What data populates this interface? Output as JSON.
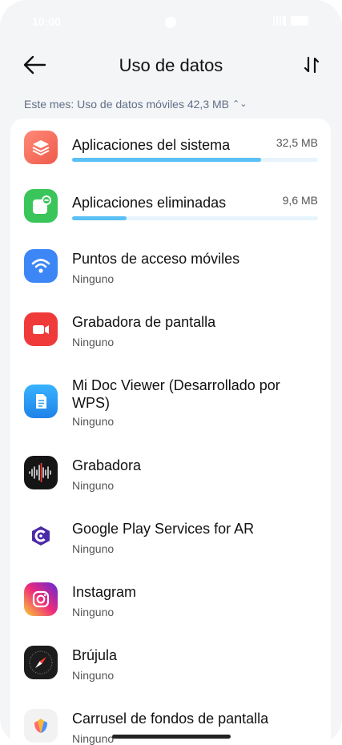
{
  "statusbar": {
    "time": "10:00"
  },
  "header": {
    "title": "Uso de datos"
  },
  "period": {
    "label": "Este mes: Uso de datos móviles 42,3 MB"
  },
  "apps": [
    {
      "name": "Aplicaciones del sistema",
      "usage": "32,5 MB",
      "fraction": 0.77,
      "icon": "layers-icon",
      "color": "#f06b5a"
    },
    {
      "name": "Aplicaciones eliminadas",
      "usage": "9,6 MB",
      "fraction": 0.22,
      "icon": "removed-apps-icon",
      "color": "#3ac55b"
    },
    {
      "name": "Puntos de acceso móviles",
      "sub": "Ninguno",
      "icon": "wifi-hotspot-icon",
      "color": "#3d86f6"
    },
    {
      "name": "Grabadora de pantalla",
      "sub": "Ninguno",
      "icon": "video-camera-icon",
      "color": "#f03a3a"
    },
    {
      "name": "Mi Doc Viewer (Desarrollado por WPS)",
      "sub": "Ninguno",
      "icon": "document-icon",
      "color": "#2f9cf2"
    },
    {
      "name": "Grabadora",
      "sub": "Ninguno",
      "icon": "waveform-icon",
      "color": "#151515"
    },
    {
      "name": "Google Play Services for AR",
      "sub": "Ninguno",
      "icon": "arcore-icon",
      "color": "#ffffff"
    },
    {
      "name": "Instagram",
      "sub": "Ninguno",
      "icon": "instagram-icon",
      "color": "#d62976"
    },
    {
      "name": "Brújula",
      "sub": "Ninguno",
      "icon": "compass-icon",
      "color": "#1c1c1c"
    },
    {
      "name": "Carrusel de fondos de pantalla",
      "sub": "Ninguno",
      "icon": "wallpaper-carousel-icon",
      "color": "#f2f2f2"
    }
  ]
}
